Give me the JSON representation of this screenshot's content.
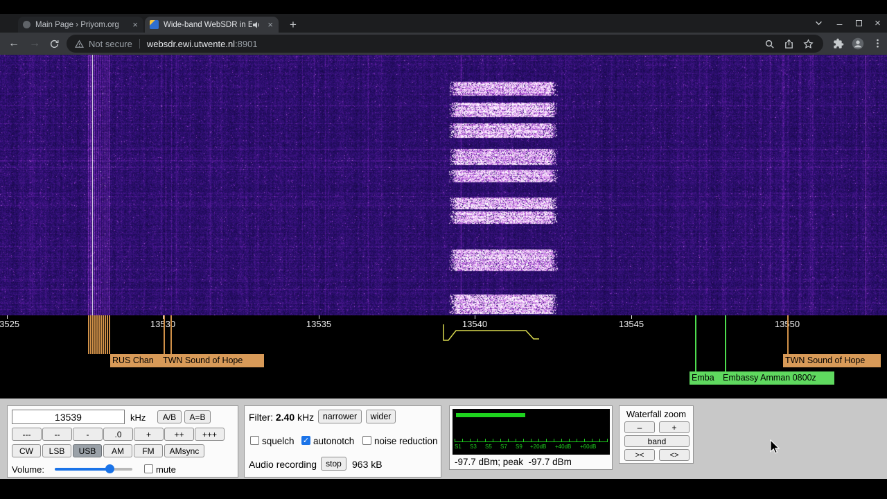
{
  "browser": {
    "tabs": [
      {
        "title": "Main Page › Priyom.org"
      },
      {
        "title": "Wide-band WebSDR in Ensch"
      }
    ],
    "new_tab": "+",
    "back": "←",
    "forward": "→",
    "security": "Not secure",
    "host": "websdr.ewi.utwente.nl",
    "port": ":8901",
    "close_tab": "×",
    "minimize": "–"
  },
  "scale": {
    "ticks": [
      "13525",
      "13530",
      "13535",
      "13540",
      "13545",
      "13550"
    ]
  },
  "stations": {
    "rus": "RUS Chan",
    "twn_left": "TWN Sound of Hope",
    "twn_right": "TWN Sound of Hope",
    "embassy_short": "Emba",
    "embassy": "Embassy Amman 0800z"
  },
  "freq": {
    "value": "13539",
    "unit": "kHz",
    "ab": "A/B",
    "a_eq_b": "A=B",
    "steps": [
      "---",
      "--",
      "-",
      ".0",
      "+",
      "++",
      "+++"
    ],
    "modes": [
      "CW",
      "LSB",
      "USB",
      "AM",
      "FM",
      "AMsync"
    ],
    "active_mode": "USB",
    "volume_label": "Volume:",
    "mute_label": "mute"
  },
  "filter": {
    "label": "Filter:",
    "bandwidth": "2.40",
    "unit": "kHz",
    "narrower": "narrower",
    "wider": "wider",
    "squelch": "squelch",
    "autonotch": "autonotch",
    "noise_reduction": "noise reduction",
    "recording_label": "Audio recording",
    "stop": "stop",
    "recording_size": "963 kB"
  },
  "meter": {
    "scale": [
      "S1",
      "S3",
      "S5",
      "S7",
      "S9",
      "+20dB",
      "+40dB",
      "+60dB"
    ],
    "reading": "-97.7 dBm; peak  -97.7 dBm"
  },
  "wzoom": {
    "title": "Waterfall zoom",
    "minus": "–",
    "plus": "+",
    "band": "band",
    "narrow": "><",
    "wide": "<>"
  },
  "glyphs": {
    "check": "✓"
  }
}
